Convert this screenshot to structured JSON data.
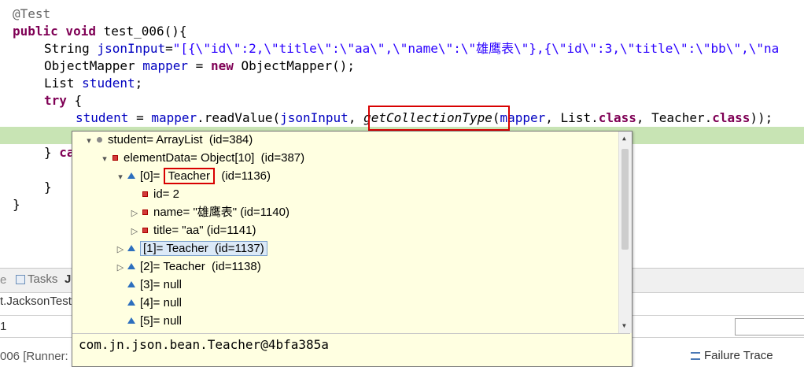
{
  "code": {
    "annotation": "@Test",
    "line2_kw": "public void",
    "line2_rest": " test_006(){",
    "line3_type": "String ",
    "line3_var": "jsonInput",
    "line3_eq": "=",
    "line3_str": "\"[{\\\"id\\\":2,\\\"title\\\":\\\"aa\\\",\\\"name\\\":\\\"雄鹰表\\\"},{\\\"id\\\":3,\\\"title\\\":\\\"bb\\\",\\\"na",
    "line4_pre": "ObjectMapper ",
    "line4_var": "mapper",
    "line4_mid": " = ",
    "line4_kw": "new",
    "line4_post": " ObjectMapper();",
    "line5_pre": "List ",
    "line5_var": "student",
    "line5_post": ";",
    "line6_kw": "try",
    "line6_post": " {",
    "line7_var1": "student",
    "line7_mid1": " = ",
    "line7_var2": "mapper",
    "line7_mid2": ".readValue(",
    "line7_var3": "jsonInput",
    "line7_mid3": ", ",
    "line7_method": "getCollectionType",
    "line7_mid4": "(",
    "line7_var4": "mapper",
    "line7_mid5": ", List.",
    "line7_kw1": "class",
    "line7_mid6": ", Teacher.",
    "line7_kw2": "class",
    "line7_end": "));",
    "line9_brace": "} ",
    "line9_kw": "ca",
    "line11": "}",
    "line12": "}"
  },
  "bottom": {
    "tab_tasks": "Tasks",
    "tab_partial": "J",
    "runner_class": "t.JacksonTest",
    "runs_value": "1",
    "run_label": "006 [Runner:",
    "failure_trace": "Failure Trace"
  },
  "popup": {
    "rows": [
      {
        "twisty": "▾",
        "icon": "circle",
        "text": "student= ArrayList  (id=384)"
      },
      {
        "twisty": "▾",
        "icon": "field",
        "text": "elementData= Object[10]  (id=387)"
      },
      {
        "twisty": "▾",
        "icon": "tri",
        "pre": "[0]= ",
        "boxed": "Teacher",
        "post": "  (id=1136)"
      },
      {
        "twisty": "",
        "icon": "field",
        "text": "id= 2"
      },
      {
        "twisty": "▷",
        "icon": "field",
        "text": "name= \"雄鹰表\" (id=1140)"
      },
      {
        "twisty": "▷",
        "icon": "field",
        "text": "title= \"aa\" (id=1141)"
      },
      {
        "twisty": "▷",
        "icon": "tri",
        "text": "[1]= Teacher  (id=1137)"
      },
      {
        "twisty": "▷",
        "icon": "tri",
        "text": "[2]= Teacher  (id=1138)"
      },
      {
        "twisty": "",
        "icon": "tri",
        "text": "[3]= null"
      },
      {
        "twisty": "",
        "icon": "tri",
        "text": "[4]= null"
      },
      {
        "twisty": "",
        "icon": "tri",
        "text": "[5]= null"
      }
    ],
    "detail_text": "com.jn.json.bean.Teacher@4bfa385a"
  },
  "colors": {
    "keyword": "#7f0055",
    "string": "#2a00ff",
    "field": "#0000c0",
    "highlight_line": "#c8e4b4",
    "popup_bg": "#ffffe1",
    "redbox": "#d80000"
  }
}
